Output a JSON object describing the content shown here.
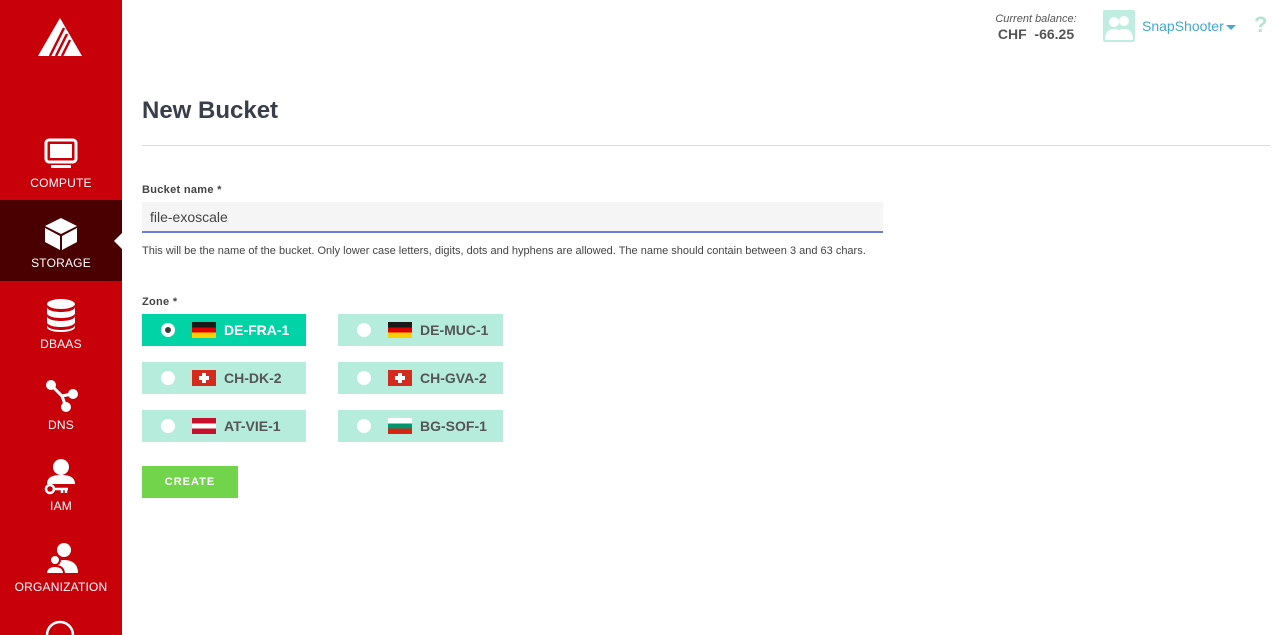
{
  "sidebar": {
    "items": [
      {
        "label": "COMPUTE",
        "icon": "monitor-icon"
      },
      {
        "label": "STORAGE",
        "icon": "cube-icon"
      },
      {
        "label": "DBAAS",
        "icon": "database-icon"
      },
      {
        "label": "DNS",
        "icon": "share-nodes-icon"
      },
      {
        "label": "IAM",
        "icon": "user-key-icon"
      },
      {
        "label": "ORGANIZATION",
        "icon": "users-icon"
      }
    ],
    "active": "STORAGE",
    "color": "#c8000a",
    "active_color": "#4a0000"
  },
  "header": {
    "balance_label": "Current balance:",
    "balance_value": "CHF  -66.25",
    "username": "SnapShooter",
    "help": "?"
  },
  "page": {
    "title": "New Bucket"
  },
  "form": {
    "bucket_name_label": "Bucket name *",
    "bucket_name_value": "file-exoscale",
    "help_text": "This will be the name of the bucket. Only lower case letters, digits, dots and hyphens are allowed. The name should contain between 3 and 63 chars.",
    "zone_label": "Zone *",
    "zones": [
      {
        "name": "DE-FRA-1",
        "flag": "de",
        "selected": true
      },
      {
        "name": "DE-MUC-1",
        "flag": "de",
        "selected": false
      },
      {
        "name": "CH-DK-2",
        "flag": "ch",
        "selected": false
      },
      {
        "name": "CH-GVA-2",
        "flag": "ch",
        "selected": false
      },
      {
        "name": "AT-VIE-1",
        "flag": "at",
        "selected": false
      },
      {
        "name": "BG-SOF-1",
        "flag": "bg",
        "selected": false
      }
    ],
    "create_label": "CREATE"
  }
}
